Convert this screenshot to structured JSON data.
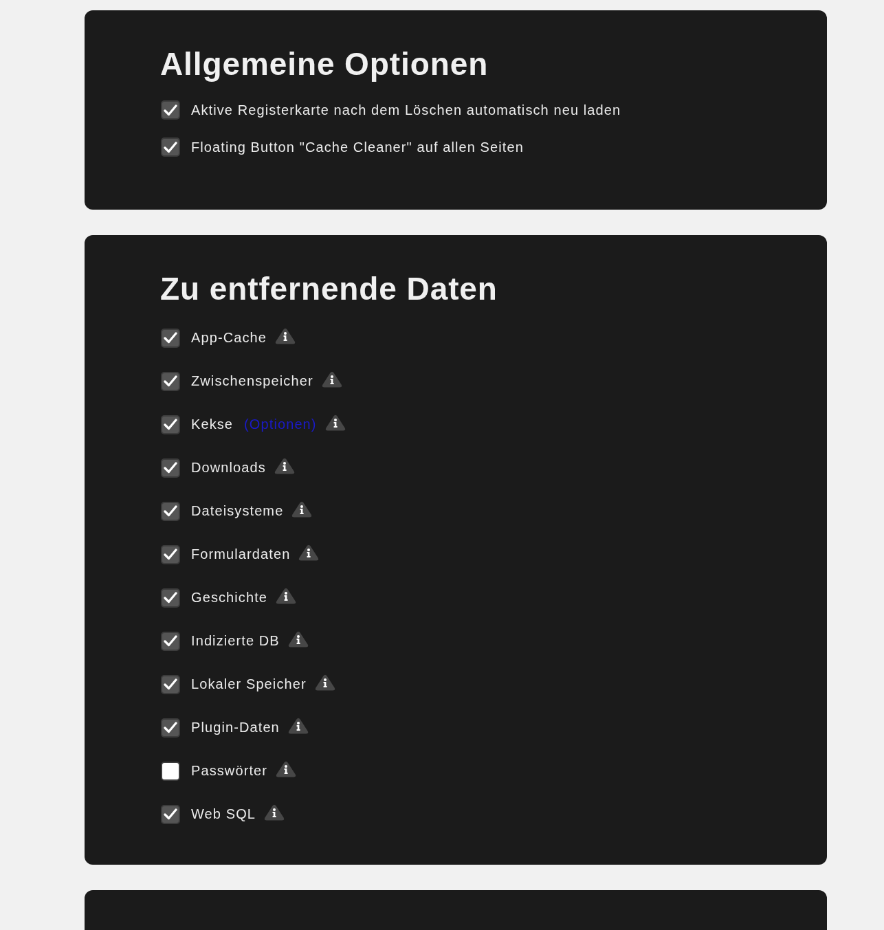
{
  "sections": [
    {
      "title": "Allgemeine Optionen",
      "options": [
        {
          "label": "Aktive Registerkarte nach dem Löschen automatisch neu laden",
          "checked": true,
          "info": false
        },
        {
          "label": "Floating Button \"Cache Cleaner\" auf allen Seiten",
          "checked": true,
          "info": false
        }
      ]
    },
    {
      "title": "Zu entfernende Daten",
      "options": [
        {
          "label": "App-Cache",
          "checked": true,
          "info": true
        },
        {
          "label": "Zwischenspeicher",
          "checked": true,
          "info": true
        },
        {
          "label": "Kekse",
          "link": "(Optionen)",
          "checked": true,
          "info": true
        },
        {
          "label": "Downloads",
          "checked": true,
          "info": true
        },
        {
          "label": "Dateisysteme",
          "checked": true,
          "info": true
        },
        {
          "label": "Formulardaten",
          "checked": true,
          "info": true
        },
        {
          "label": "Geschichte",
          "checked": true,
          "info": true
        },
        {
          "label": "Indizierte DB",
          "checked": true,
          "info": true
        },
        {
          "label": "Lokaler Speicher",
          "checked": true,
          "info": true
        },
        {
          "label": "Plugin-Daten",
          "checked": true,
          "info": true
        },
        {
          "label": "Passwörter",
          "checked": false,
          "info": true
        },
        {
          "label": "Web SQL",
          "checked": true,
          "info": true
        }
      ]
    }
  ]
}
